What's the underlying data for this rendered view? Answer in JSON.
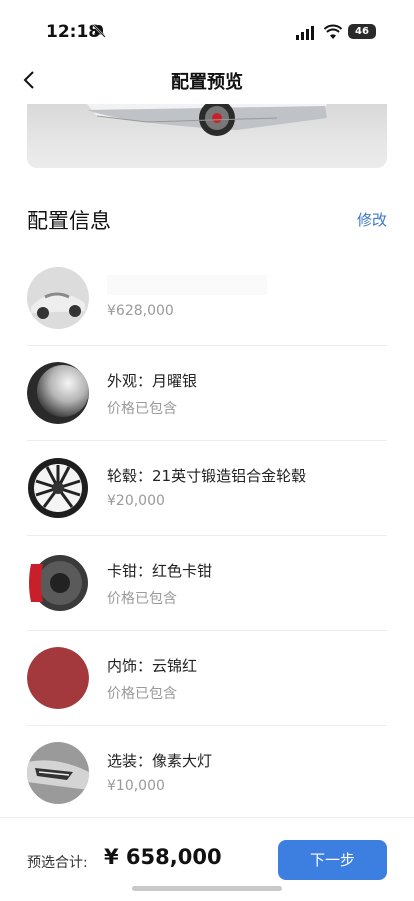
{
  "status": {
    "time": "12:18",
    "battery": "46"
  },
  "nav": {
    "title": "配置预览"
  },
  "section": {
    "title": "配置信息",
    "edit_label": "修改"
  },
  "items": [
    {
      "name": "",
      "price": "¥628,000",
      "icon": "car-model-icon"
    },
    {
      "name": "外观：月曜银",
      "price": "价格已包含",
      "icon": "paint-silver-icon"
    },
    {
      "name": "轮毂：21英寸锻造铝合金轮毂",
      "price": "¥20,000",
      "icon": "wheel-icon"
    },
    {
      "name": "卡钳：红色卡钳",
      "price": "价格已包含",
      "icon": "caliper-icon"
    },
    {
      "name": "内饰：云锦红",
      "price": "价格已包含",
      "icon": "interior-red-icon"
    },
    {
      "name": "选装：像素大灯",
      "price": "¥10,000",
      "icon": "headlight-icon"
    }
  ],
  "footer": {
    "total_label": "预选合计:",
    "total_value": "¥ 658,000",
    "next_label": "下一步"
  },
  "colors": {
    "accent": "#3d7fe0",
    "link": "#3c78c8",
    "caliper": "#c8202a",
    "interior": "#a3393c"
  }
}
